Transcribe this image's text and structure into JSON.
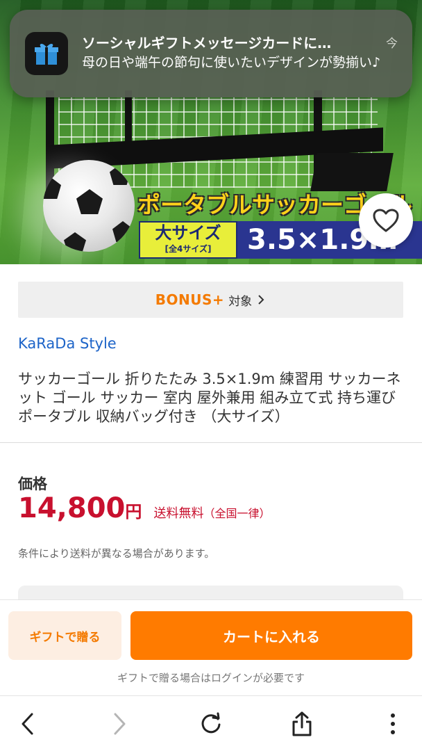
{
  "notification": {
    "title": "ソーシャルギフトメッセージカードに…",
    "time": "今",
    "body": "母の日や端午の節句に使いたいデザインが勢揃い♪",
    "icon": "gift-icon"
  },
  "hero": {
    "headline": "ポータブルサッカーゴール",
    "size_badge": "大サイズ",
    "size_sub": "[全4サイズ]",
    "dimensions": "3.5×1.9m",
    "favorite_icon": "heart-icon"
  },
  "bonus": {
    "logo": "BONUS+",
    "label": "対象",
    "chevron": "›"
  },
  "shop": {
    "name": "KaRaDa Style"
  },
  "product": {
    "title": "サッカーゴール 折りたたみ 3.5×1.9m 練習用 サッカーネット ゴール サッカー 室内 屋外兼用 組み立て式 持ち運び ポータブル 収納バッグ付き （大サイズ）"
  },
  "price": {
    "label": "価格",
    "amount": "14,800",
    "currency": "円",
    "shipping": "送料無料",
    "shipping_note": "（全国一律）",
    "condition_note": "条件により送料が異なる場合があります。"
  },
  "actions": {
    "gift_label": "ギフトで贈る",
    "cart_label": "カートに入れる",
    "login_note": "ギフトで贈る場合はログインが必要です"
  },
  "browser": {
    "back_icon": "back-arrow-icon",
    "forward_icon": "forward-arrow-icon",
    "reload_icon": "reload-icon",
    "share_icon": "share-icon",
    "menu_icon": "more-vertical-icon"
  },
  "colors": {
    "accent_orange": "#ff7b00",
    "price_red": "#c8102e",
    "link_blue": "#1d64c8"
  }
}
